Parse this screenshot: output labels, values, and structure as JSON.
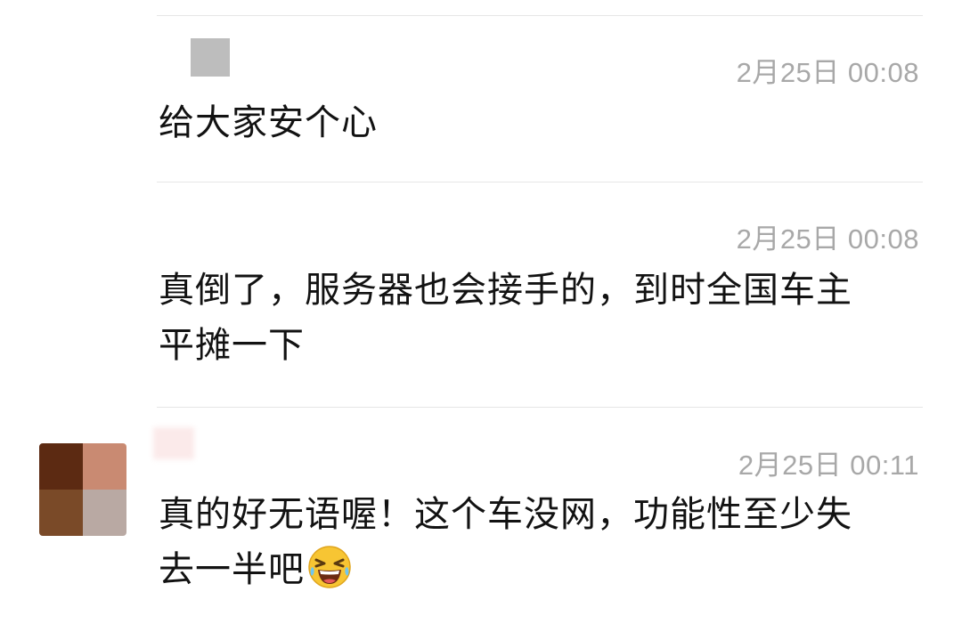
{
  "comments": [
    {
      "time": "2月25日 00:08",
      "text": "给大家安个心"
    },
    {
      "time": "2月25日 00:08",
      "text_line1": "真倒了，服务器也会接手的，到时全国车主",
      "text_line2": "平摊一下"
    },
    {
      "time": "2月25日 00:11",
      "text_line1": "真的好无语喔！这个车没网，功能性至少失",
      "text_line2": "去一半吧",
      "emoji": "grinning-squinting-tears-face-icon"
    }
  ],
  "colors": {
    "divider": "#e6e6e6",
    "timestamp": "#a8a8a8",
    "text": "#121212"
  }
}
